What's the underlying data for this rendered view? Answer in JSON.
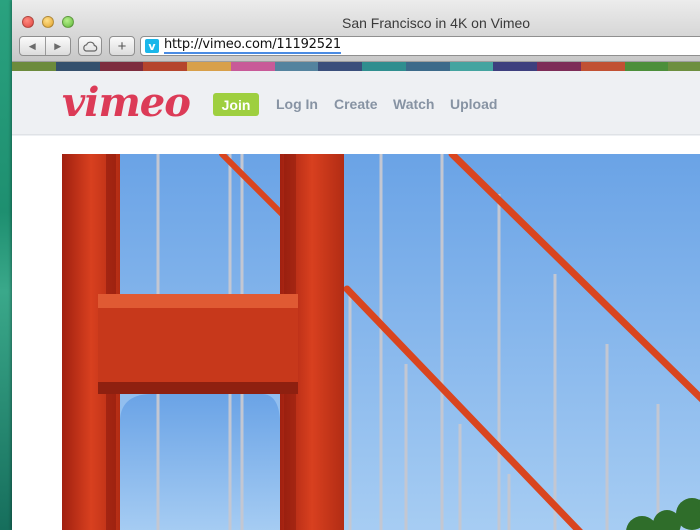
{
  "window": {
    "title": "San Francisco in 4K on Vimeo",
    "address": "http://vimeo.com/11192521",
    "favicon_letter": "v"
  },
  "toolbar": {
    "back_icon": "back-arrow-icon",
    "forward_icon": "forward-arrow-icon",
    "cloud_icon": "icloud-tabs-icon",
    "new_tab_label": "+"
  },
  "color_strip": [
    "#6c8b3c",
    "#34506d",
    "#7d2c3e",
    "#b5452d",
    "#d8a04a",
    "#c85a98",
    "#54839e",
    "#3a4e7b",
    "#2f8e8f",
    "#3c6a8a",
    "#44a4a0",
    "#3d3f7e",
    "#7d2c57",
    "#c15133",
    "#4c8f3a",
    "#6d8f3f"
  ],
  "vimeo": {
    "logo_text": "vimeo",
    "brand_color": "#dc3b57",
    "join_label": "Join",
    "join_color": "#9ecf3f",
    "nav": [
      "Log In",
      "Create",
      "Watch",
      "Upload"
    ],
    "nav_color": "#8793a3"
  },
  "video": {
    "subject": "golden-gate-bridge-tower-image"
  }
}
